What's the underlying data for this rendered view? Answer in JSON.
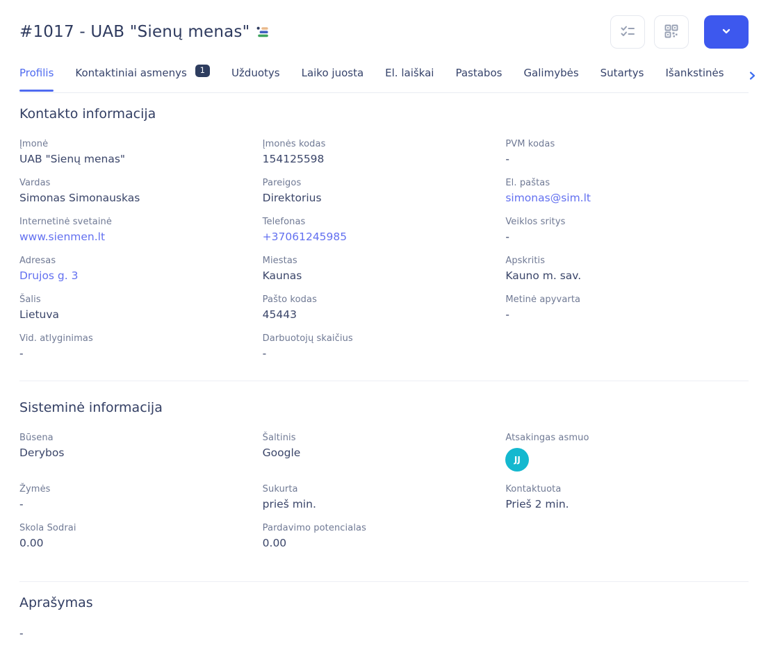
{
  "colors": {
    "primary_blue": "#3d58ee",
    "link_blue": "#6270f0",
    "active_tab_blue": "#4f6bf0",
    "badge_navy": "#2e3d5f",
    "avatar_teal": "#14b8cf"
  },
  "header": {
    "title": "#1017 - UAB \"Sienų menas\"",
    "icons": {
      "company_status": "stacked-bars-icon",
      "checklist": "checklist-icon",
      "qr": "qr-code-icon",
      "dropdown": "chevron-down-icon"
    }
  },
  "tabs": {
    "items": [
      {
        "label": "Profilis",
        "active": true
      },
      {
        "label": "Kontaktiniai asmenys",
        "badge": "1"
      },
      {
        "label": "Užduotys"
      },
      {
        "label": "Laiko juosta"
      },
      {
        "label": "El. laiškai"
      },
      {
        "label": "Pastabos"
      },
      {
        "label": "Galimybės"
      },
      {
        "label": "Sutartys"
      },
      {
        "label": "Išankstinės"
      }
    ],
    "scroll_right_icon": "chevron-right-icon"
  },
  "sections": {
    "contact": {
      "heading": "Kontakto informacija",
      "fields": [
        {
          "label": "Įmonė",
          "value": "UAB \"Sienų menas\""
        },
        {
          "label": "Įmonės kodas",
          "value": "154125598"
        },
        {
          "label": "PVM kodas",
          "value": "-"
        },
        {
          "label": "Vardas",
          "value": "Simonas Simonauskas"
        },
        {
          "label": "Pareigos",
          "value": "Direktorius"
        },
        {
          "label": "El. paštas",
          "value": "simonas@sim.lt",
          "type": "link"
        },
        {
          "label": "Internetinė svetainė",
          "value": "www.sienmen.lt",
          "type": "link"
        },
        {
          "label": "Telefonas",
          "value": "+37061245985",
          "type": "link"
        },
        {
          "label": "Veiklos sritys",
          "value": "-"
        },
        {
          "label": "Adresas",
          "value": "Drujos g. 3",
          "type": "link"
        },
        {
          "label": "Miestas",
          "value": "Kaunas"
        },
        {
          "label": "Apskritis",
          "value": "Kauno m. sav."
        },
        {
          "label": "Šalis",
          "value": "Lietuva"
        },
        {
          "label": "Pašto kodas",
          "value": "45443"
        },
        {
          "label": "Metinė apyvarta",
          "value": "-"
        },
        {
          "label": "Vid. atlyginimas",
          "value": "-"
        },
        {
          "label": "Darbuotojų skaičius",
          "value": "-"
        }
      ]
    },
    "system": {
      "heading": "Sisteminė informacija",
      "fields": [
        {
          "label": "Būsena",
          "value": "Derybos"
        },
        {
          "label": "Šaltinis",
          "value": "Google"
        },
        {
          "label": "Atsakingas asmuo",
          "value": "JJ",
          "type": "avatar"
        },
        {
          "label": "Žymės",
          "value": "-"
        },
        {
          "label": "Sukurta",
          "value": "prieš min."
        },
        {
          "label": "Kontaktuota",
          "value": "Prieš 2 min."
        },
        {
          "label": "Skola Sodrai",
          "value": "0.00"
        },
        {
          "label": "Pardavimo potencialas",
          "value": "0.00"
        }
      ]
    },
    "description": {
      "heading": "Aprašymas",
      "text": "-"
    }
  }
}
